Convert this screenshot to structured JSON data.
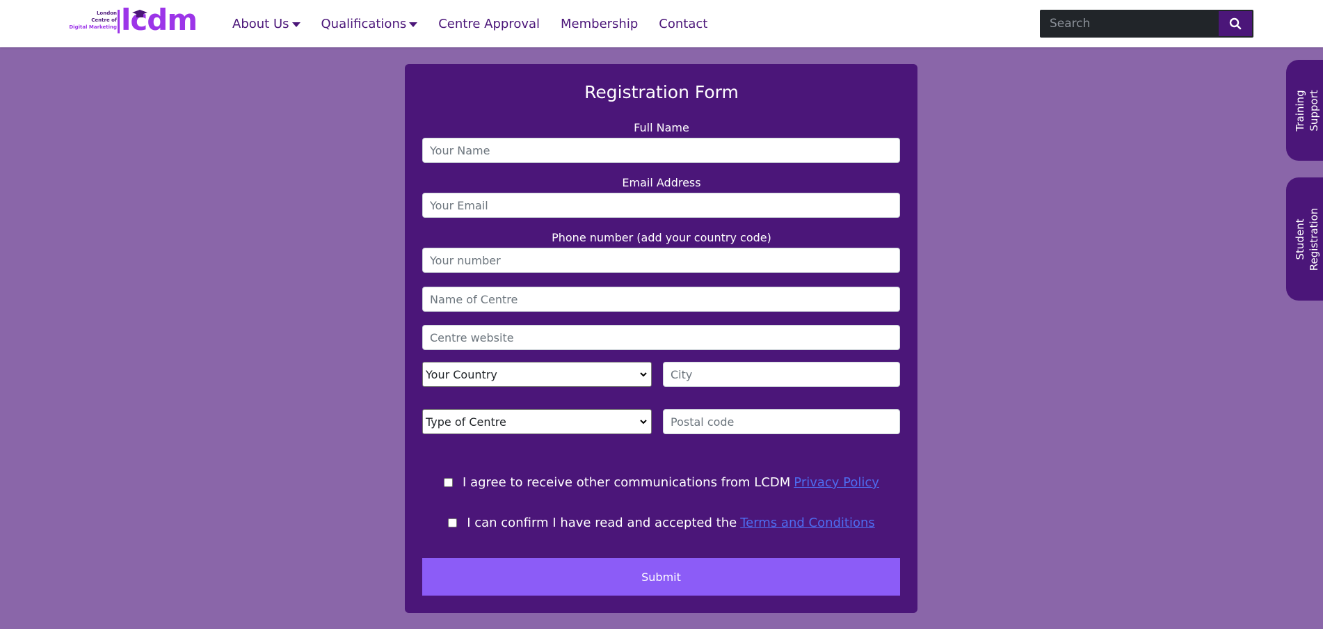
{
  "header": {
    "logo": {
      "small_line1": "London",
      "small_line2": "Centre of",
      "small_line3": "Digital Marketing",
      "big": "lcdm"
    },
    "nav": [
      {
        "label": "About Us",
        "has_dropdown": true
      },
      {
        "label": "Qualifications",
        "has_dropdown": true
      },
      {
        "label": "Centre Approval",
        "has_dropdown": false
      },
      {
        "label": "Membership",
        "has_dropdown": false
      },
      {
        "label": "Contact",
        "has_dropdown": false
      }
    ],
    "search": {
      "placeholder": "Search",
      "icon": "search-icon"
    }
  },
  "form": {
    "title": "Registration Form",
    "full_name": {
      "label": "Full Name",
      "placeholder": "Your Name"
    },
    "email": {
      "label": "Email Address",
      "placeholder": "Your Email"
    },
    "phone": {
      "label": "Phone number (add your country code)",
      "placeholder": "Your number"
    },
    "centre_name": {
      "placeholder": "Name of Centre"
    },
    "centre_website": {
      "placeholder": "Centre website"
    },
    "country": {
      "selected": "Your Country"
    },
    "city": {
      "placeholder": "City"
    },
    "centre_type": {
      "selected": "Type of Centre"
    },
    "postal_code": {
      "placeholder": "Postal code"
    },
    "consent_communications": {
      "text": "I agree to receive other communications from LCDM",
      "link": "Privacy Policy",
      "checked": false
    },
    "consent_terms": {
      "text": "I can confirm I have read and accepted the",
      "link": "Terms and Conditions",
      "checked": false
    },
    "submit_label": "Submit"
  },
  "side_tabs": {
    "training_support": [
      "Training",
      "Support"
    ],
    "student_registration": [
      "Student",
      "Registration"
    ]
  },
  "colors": {
    "page_bg": "#8a66a9",
    "brand_purple": "#4b1679",
    "logo_purple": "#9c35e8",
    "submit_bg": "#8c5cf7",
    "link": "#4e6cf0"
  }
}
